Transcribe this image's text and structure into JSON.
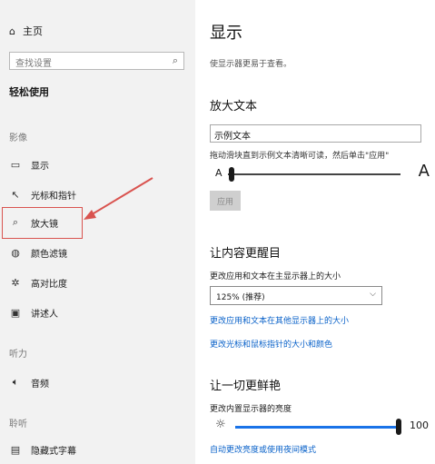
{
  "sidebar": {
    "home_label": "主页",
    "search_placeholder": "查找设置",
    "section_title": "轻松使用",
    "groups": [
      {
        "label": "影像"
      },
      {
        "label": "听力"
      },
      {
        "label": "聆听"
      }
    ],
    "items": [
      {
        "label": "显示",
        "icon": "monitor-icon"
      },
      {
        "label": "光标和指针",
        "icon": "pointer-icon"
      },
      {
        "label": "放大镜",
        "icon": "magnifier-icon"
      },
      {
        "label": "颜色滤镜",
        "icon": "color-filter-icon"
      },
      {
        "label": "高对比度",
        "icon": "contrast-icon"
      },
      {
        "label": "讲述人",
        "icon": "narrator-icon"
      },
      {
        "label": "音频",
        "icon": "speaker-icon"
      },
      {
        "label": "隐藏式字幕",
        "icon": "captions-icon"
      }
    ]
  },
  "main": {
    "title": "显示",
    "subtitle": "使显示器更易于查看。",
    "text_section": {
      "heading": "放大文本",
      "input_value": "示例文本",
      "hint": "拖动滑块直到示例文本清晰可读，然后单击\"应用\"",
      "slider_small": "A",
      "slider_big": "A",
      "slider_level": 0.02,
      "apply_label": "应用"
    },
    "bigger_section": {
      "heading": "让内容更醒目",
      "label": "更改应用和文本在主显示器上的大小",
      "select_value": "125% (推荐)",
      "link1": "更改应用和文本在其他显示器上的大小",
      "link2": "更改光标和鼠标指针的大小和颜色"
    },
    "bright_section": {
      "heading": "让一切更鲜艳",
      "label": "更改内置显示器的亮度",
      "value": "100",
      "level": 1.0,
      "link": "自动更改亮度或使用夜间模式"
    }
  },
  "colors": {
    "accent": "#1a73e8",
    "link": "#0a62c9",
    "highlight": "#d9534f"
  }
}
